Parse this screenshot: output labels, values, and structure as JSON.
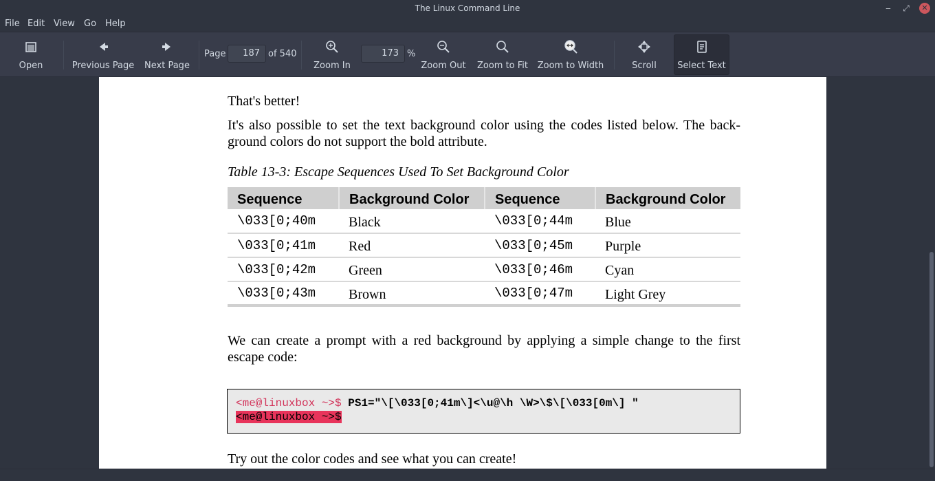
{
  "window": {
    "title": "The Linux Command Line",
    "min": "‒",
    "max": "⤢",
    "close": "✕"
  },
  "menu": [
    "File",
    "Edit",
    "View",
    "Go",
    "Help"
  ],
  "toolbar": {
    "open": "Open",
    "prev": "Previous Page",
    "next": "Next Page",
    "page_label": "Page",
    "page_value": "187",
    "page_of": "of 540",
    "zoom_in": "Zoom In",
    "zoom_value": "173",
    "zoom_unit": "%",
    "zoom_out": "Zoom Out",
    "zoom_fit": "Zoom to Fit",
    "zoom_width": "Zoom to Width",
    "scroll": "Scroll",
    "select_text": "Select Text"
  },
  "doc": {
    "p1": "That's better!",
    "p2": "It's also possible to set the text background color using the codes listed below. The back-ground colors do not support the bold attribute.",
    "caption": "Table 13-3: Escape Sequences Used To Set Background Color",
    "table": {
      "headers": [
        "Sequence",
        "Background Color",
        "Sequence",
        "Background Color"
      ],
      "rows": [
        [
          "\\033[0;40m",
          "Black",
          "\\033[0;44m",
          "Blue"
        ],
        [
          "\\033[0;41m",
          "Red",
          "\\033[0;45m",
          "Purple"
        ],
        [
          "\\033[0;42m",
          "Green",
          "\\033[0;46m",
          "Cyan"
        ],
        [
          "\\033[0;43m",
          "Brown",
          "\\033[0;47m",
          "Light Grey"
        ]
      ]
    },
    "p3": "We can create a prompt with a red background by applying a simple change to the first escape code:",
    "code": {
      "prompt1": "<me@linuxbox ~>$ ",
      "command": "PS1=\"\\[\\033[0;41m\\]<\\u@\\h \\W>\\$\\[\\033[0m\\] \"",
      "prompt2": "<me@linuxbox ~>$"
    },
    "p4": "Try out the color codes and see what you can create!"
  }
}
